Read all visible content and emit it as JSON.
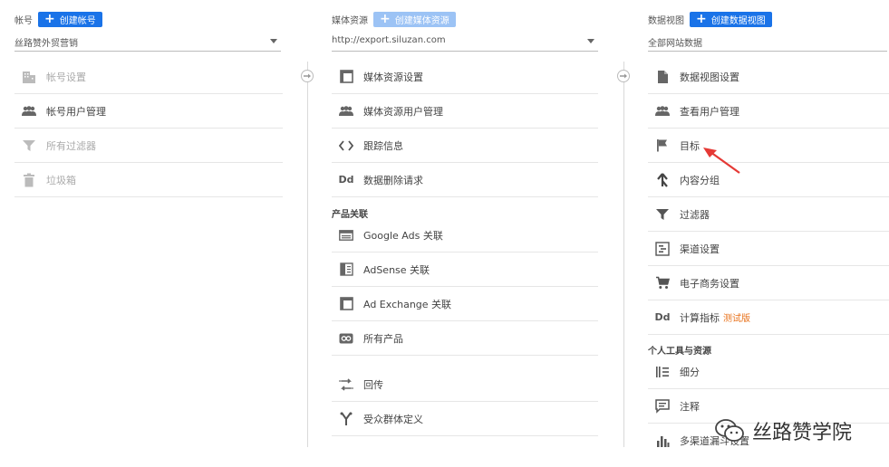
{
  "account": {
    "title": "帐号",
    "create_label": "创建帐号",
    "selected": "丝路赞外贸营销",
    "items": [
      {
        "label": "帐号设置",
        "icon": "building-icon",
        "disabled": true
      },
      {
        "label": "帐号用户管理",
        "icon": "users-icon",
        "disabled": false
      },
      {
        "label": "所有过滤器",
        "icon": "filter-icon",
        "disabled": true
      },
      {
        "label": "垃圾箱",
        "icon": "trash-icon",
        "disabled": true
      }
    ]
  },
  "property": {
    "title": "媒体资源",
    "create_label": "创建媒体资源",
    "selected": "http://export.siluzan.com",
    "items": [
      {
        "label": "媒体资源设置",
        "icon": "window-icon"
      },
      {
        "label": "媒体资源用户管理",
        "icon": "users-icon"
      },
      {
        "label": "跟踪信息",
        "icon": "code-icon"
      },
      {
        "label": "数据删除请求",
        "icon": "dd-icon"
      }
    ],
    "product_linking_title": "产品关联",
    "product_items": [
      {
        "label": "Google Ads 关联",
        "icon": "ads-icon"
      },
      {
        "label": "AdSense 关联",
        "icon": "adsense-icon"
      },
      {
        "label": "Ad Exchange 关联",
        "icon": "adexchange-icon"
      },
      {
        "label": "所有产品",
        "icon": "link-icon"
      }
    ],
    "other_items": [
      {
        "label": "回传",
        "icon": "postback-icon"
      },
      {
        "label": "受众群体定义",
        "icon": "audience-icon"
      }
    ]
  },
  "view": {
    "title": "数据视图",
    "create_label": "创建数据视图",
    "selected": "全部网站数据",
    "items": [
      {
        "label": "数据视图设置",
        "icon": "document-icon"
      },
      {
        "label": "查看用户管理",
        "icon": "users-icon"
      },
      {
        "label": "目标",
        "icon": "flag-icon"
      },
      {
        "label": "内容分组",
        "icon": "content-grouping-icon"
      },
      {
        "label": "过滤器",
        "icon": "filter-icon"
      },
      {
        "label": "渠道设置",
        "icon": "channel-settings-icon"
      },
      {
        "label": "电子商务设置",
        "icon": "cart-icon"
      },
      {
        "label": "计算指标",
        "icon": "dd-icon",
        "badge": "测试版"
      }
    ],
    "personal_title": "个人工具与资源",
    "personal_items": [
      {
        "label": "细分",
        "icon": "segments-icon"
      },
      {
        "label": "注释",
        "icon": "annotation-icon"
      },
      {
        "label": "多渠道漏斗设置",
        "icon": "bar-chart-icon"
      }
    ]
  },
  "watermark": {
    "text": "丝路赞学院"
  }
}
